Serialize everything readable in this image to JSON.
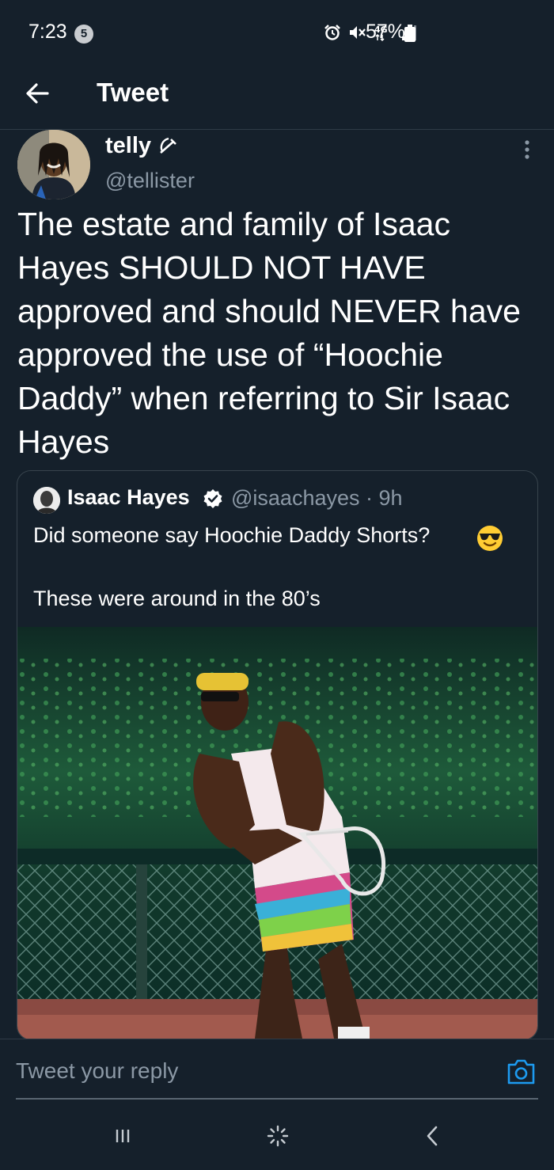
{
  "status_bar": {
    "time": "7:23",
    "notification_count": "5",
    "battery": "57%"
  },
  "header": {
    "title": "Tweet"
  },
  "tweet": {
    "author_name": "telly",
    "author_handle": "@tellister",
    "text": "The estate and family of Isaac Hayes SHOULD NOT HAVE approved and should NEVER have approved the use of “Hoochie Daddy” when referring to Sir Isaac Hayes"
  },
  "quoted_tweet": {
    "author_name": "Isaac Hayes",
    "handle_time": "@isaachayes · 9h",
    "line1": "Did someone say Hoochie Daddy Shorts?",
    "line2": "These were around in the 80’s"
  },
  "reply": {
    "placeholder": "Tweet your reply"
  },
  "colors": {
    "background": "#15202b",
    "secondary_text": "#8b98a5",
    "accent": "#1d9bf0"
  }
}
